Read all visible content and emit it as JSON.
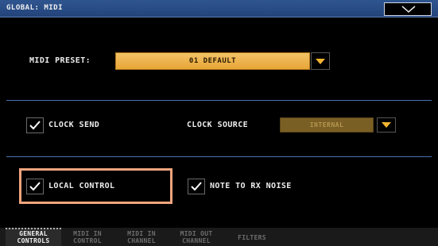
{
  "window": {
    "title": "GLOBAL: MIDI",
    "menu_icon": "chevron-down-icon"
  },
  "midi_preset": {
    "label": "MIDI PRESET:",
    "value": "01 DEFAULT"
  },
  "clock_send": {
    "label": "CLOCK SEND",
    "checked": true
  },
  "clock_source": {
    "label": "CLOCK SOURCE",
    "value": "INTERNAL",
    "enabled": false
  },
  "local_control": {
    "label": "LOCAL CONTROL",
    "checked": true
  },
  "note_to_rx_noise": {
    "label": "NOTE TO RX NOISE",
    "checked": true
  },
  "tabs": [
    {
      "line1": "GENERAL",
      "line2": "CONTROLS",
      "active": true
    },
    {
      "line1": "MIDI IN",
      "line2": "CONTROL",
      "active": false
    },
    {
      "line1": "MIDI IN",
      "line2": "CHANNEL",
      "active": false
    },
    {
      "line1": "MIDI OUT",
      "line2": "CHANNEL",
      "active": false
    },
    {
      "line1": "FILTERS",
      "line2": "",
      "active": false
    }
  ],
  "colors": {
    "accent": "#e8a637",
    "title_bar": "#2f5590",
    "highlight": "#f0a57c",
    "separator": "#4a70b3"
  }
}
